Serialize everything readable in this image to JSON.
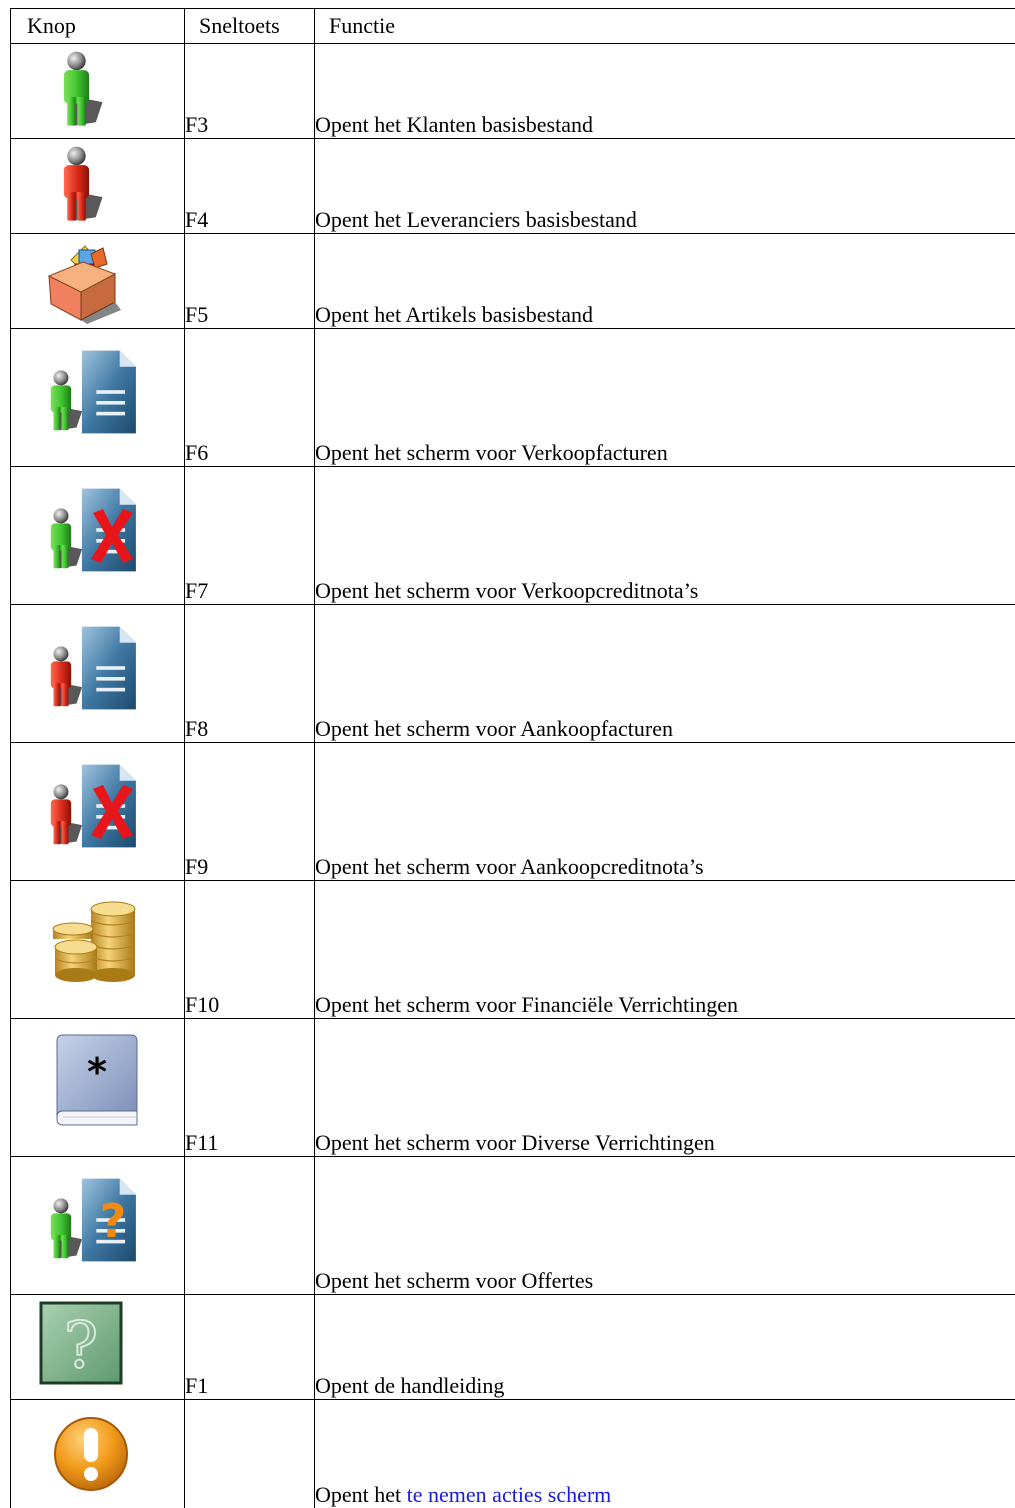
{
  "table": {
    "headers": {
      "button": "Knop",
      "shortcut": "Sneltoets",
      "function": "Functie"
    },
    "rows": [
      {
        "icon": "green-person-icon",
        "key": "F3",
        "function": "Opent het Klanten basisbestand"
      },
      {
        "icon": "red-person-icon",
        "key": "F4",
        "function": "Opent het Leveranciers basisbestand"
      },
      {
        "icon": "product-box-icon",
        "key": "F5",
        "function": "Opent het Artikels basisbestand"
      },
      {
        "icon": "sales-invoice-icon",
        "key": "F6",
        "function": "Opent het scherm voor Verkoopfacturen"
      },
      {
        "icon": "sales-credit-note-icon",
        "key": "F7",
        "function": "Opent het scherm voor Verkoopcreditnota’s"
      },
      {
        "icon": "purchase-invoice-icon",
        "key": "F8",
        "function": "Opent het scherm voor Aankoopfacturen"
      },
      {
        "icon": "purchase-credit-note-icon",
        "key": "F9",
        "function": "Opent het scherm voor Aankoopcreditnota’s"
      },
      {
        "icon": "coins-icon",
        "key": "F10",
        "function": "Opent het scherm voor Financiële Verrichtingen"
      },
      {
        "icon": "journal-book-icon",
        "key": "F11",
        "function": "Opent het scherm voor Diverse Verrichtingen"
      },
      {
        "icon": "quote-icon",
        "key": "",
        "function": "Opent het scherm voor Offertes"
      },
      {
        "icon": "help-icon",
        "key": "F1",
        "function": "Opent de handleiding"
      },
      {
        "icon": "alert-icon",
        "key": "",
        "function_prefix": "Opent het ",
        "function_link": "te nemen acties scherm"
      }
    ]
  },
  "colors": {
    "customer_green": "#2fb52a",
    "supplier_red": "#d42a1c",
    "document_blue": "#2e5f86",
    "cross_red": "#e8161a",
    "question_orange": "#f08a12",
    "coin_gold": "#d9a92e",
    "book_blue": "#8c9ec0",
    "help_green": "#7fb08a",
    "alert_orange": "#e88d0c",
    "link_blue": "#1a1add"
  }
}
